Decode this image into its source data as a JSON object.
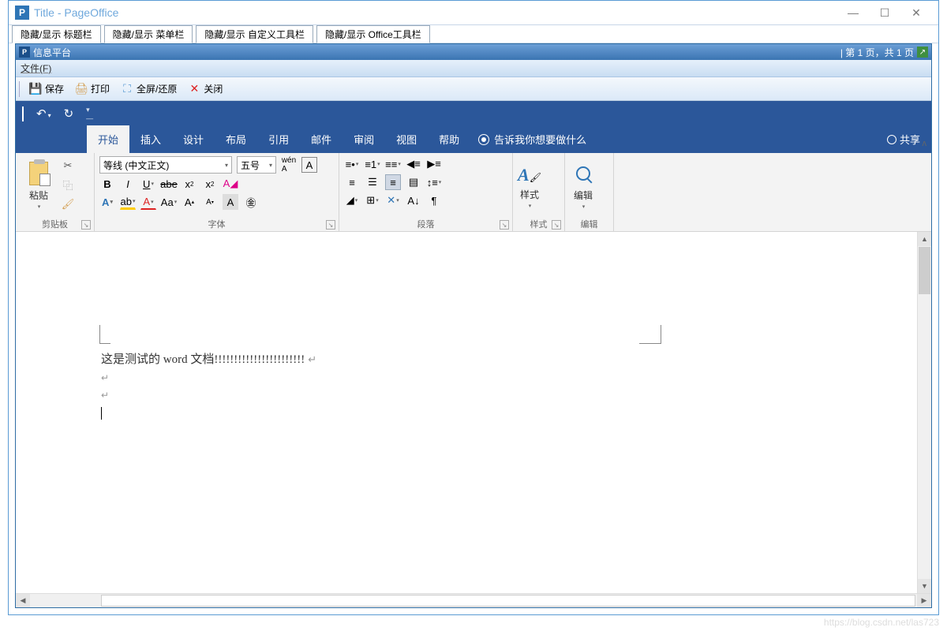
{
  "window": {
    "title": "Title - PageOffice",
    "app_icon": "P"
  },
  "toggle_tabs": [
    "隐藏/显示 标题栏",
    "隐藏/显示 菜单栏",
    "隐藏/显示 自定义工具栏",
    "隐藏/显示 Office工具栏"
  ],
  "info_bar": {
    "icon": "P",
    "title": "信息平台",
    "pages": "| 第 1 页，共 1 页"
  },
  "file_menu": "文件(F)",
  "po_toolbar": {
    "save": "保存",
    "print": "打印",
    "fullscreen": "全屏/还原",
    "close": "关闭"
  },
  "word_tabs": [
    "开始",
    "插入",
    "设计",
    "布局",
    "引用",
    "邮件",
    "审阅",
    "视图",
    "帮助"
  ],
  "tell_me": "告诉我你想要做什么",
  "share": "共享",
  "ribbon": {
    "clipboard": {
      "label": "剪贴板",
      "paste": "粘贴"
    },
    "font": {
      "label": "字体",
      "name": "等线 (中文正文)",
      "size": "五号"
    },
    "para": {
      "label": "段落"
    },
    "styles": {
      "label": "样式",
      "btn": "样式"
    },
    "edit": {
      "label": "编辑",
      "btn": "编辑"
    }
  },
  "document": {
    "line1": "这是测试的 word 文档!!!!!!!!!!!!!!!!!!!!!!!",
    "mark": "↵"
  },
  "watermark": "https://blog.csdn.net/las723"
}
